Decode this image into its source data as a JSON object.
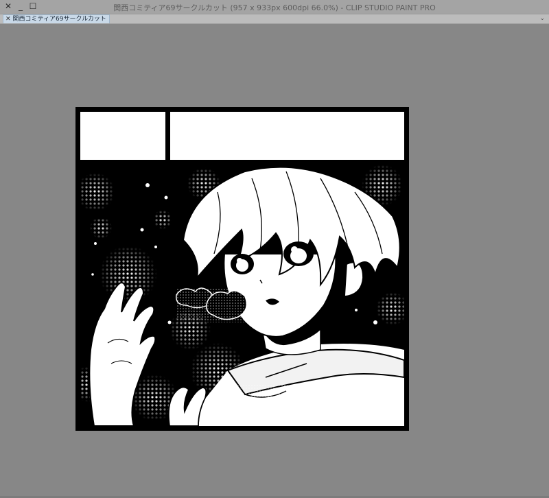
{
  "window": {
    "title": "関西コミティア69サークルカット (957 x 933px 600dpi 66.0%)  - CLIP STUDIO PAINT PRO",
    "controls": [
      "close-icon",
      "minimize-icon",
      "maximize-icon"
    ]
  },
  "tabs": [
    {
      "label": "関西コミティア69サークルカット",
      "active": true
    }
  ],
  "colors": {
    "titlebar": "#a4a4a4",
    "canvas_bg": "#878787",
    "tab_active": "#c9d9e8",
    "ink": "#000000",
    "paper": "#ffffff"
  }
}
